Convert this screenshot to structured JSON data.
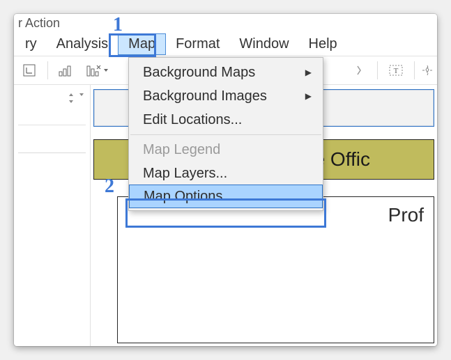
{
  "titlebar": {
    "text": "r Action"
  },
  "menubar": {
    "items": [
      {
        "label": "ry"
      },
      {
        "label": "Analysis"
      },
      {
        "label": "Map",
        "active": true
      },
      {
        "label": "Format"
      },
      {
        "label": "Window"
      },
      {
        "label": "Help"
      }
    ]
  },
  "annotations": {
    "one": "1",
    "two": "2"
  },
  "dropdown": {
    "items": [
      {
        "label": "Background Maps",
        "submenu": true
      },
      {
        "label": "Background Images",
        "submenu": true
      },
      {
        "label": "Edit Locations..."
      },
      {
        "sep": true
      },
      {
        "label": "Map Legend",
        "disabled": true
      },
      {
        "label": "Map Layers..."
      },
      {
        "label": "Map Options...",
        "hover": true
      }
    ]
  },
  "canvas": {
    "title_band": "he Offic",
    "chart_label": "Prof"
  },
  "icons": {
    "bar_chart": "bar-chart-icon",
    "bar_chart_x": "bar-chart-x-icon",
    "text_box": "text-box-icon",
    "star_outline": "star-outline-icon",
    "sort": "sort-icon",
    "dropdown_caret": "dropdown-caret-icon"
  }
}
